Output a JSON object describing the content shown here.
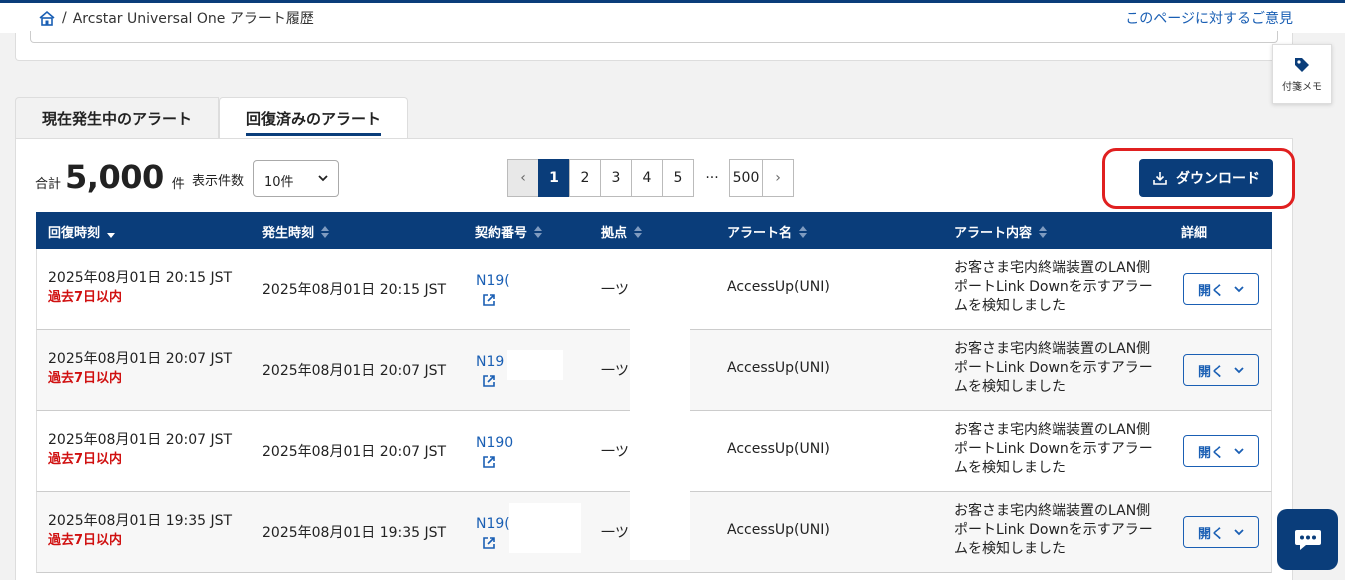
{
  "breadcrumb": {
    "separator": "/",
    "current": "Arcstar Universal One アラート履歴"
  },
  "feedback_link": "このページに対するご意見",
  "memo_button": {
    "label": "付箋メモ",
    "icon": "tag-icon"
  },
  "tabs": [
    {
      "label": "現在発生中のアラート",
      "active": false
    },
    {
      "label": "回復済みのアラート",
      "active": true
    }
  ],
  "summary": {
    "total_label": "合計",
    "total_count": "5,000",
    "total_unit": "件",
    "per_page_label": "表示件数",
    "per_page_value": "10件"
  },
  "pagination": {
    "prev": "‹",
    "pages": [
      "1",
      "2",
      "3",
      "4",
      "5"
    ],
    "ellipsis": "···",
    "last": "500",
    "next": "›",
    "current": "1"
  },
  "download_label": "ダウンロード",
  "table": {
    "headers": [
      "回復時刻",
      "発生時刻",
      "契約番号",
      "拠点",
      "アラート名",
      "アラート内容",
      "詳細"
    ],
    "rows": [
      {
        "recovered": "2025年08月01日 20:15 JST",
        "recent": "過去7日以内",
        "occurred": "2025年08月01日 20:15 JST",
        "contract": "N19(",
        "site": "一ツ",
        "alert_name": "AccessUp(UNI)",
        "alert_desc": "お客さま宅内終端装置のLAN側ポートLink Downを示すアラームを検知しました",
        "action": "開く"
      },
      {
        "recovered": "2025年08月01日 20:07 JST",
        "recent": "過去7日以内",
        "occurred": "2025年08月01日 20:07 JST",
        "contract": "N19",
        "site": "一ツ",
        "alert_name": "AccessUp(UNI)",
        "alert_desc": "お客さま宅内終端装置のLAN側ポートLink Downを示すアラームを検知しました",
        "action": "開く"
      },
      {
        "recovered": "2025年08月01日 20:07 JST",
        "recent": "過去7日以内",
        "occurred": "2025年08月01日 20:07 JST",
        "contract": "N190",
        "site": "一ツ",
        "alert_name": "AccessUp(UNI)",
        "alert_desc": "お客さま宅内終端装置のLAN側ポートLink Downを示すアラームを検知しました",
        "action": "開く"
      },
      {
        "recovered": "2025年08月01日 19:35 JST",
        "recent": "過去7日以内",
        "occurred": "2025年08月01日 19:35 JST",
        "contract": "N19(",
        "site": "一ツ",
        "alert_name": "AccessUp(UNI)",
        "alert_desc": "お客さま宅内終端装置のLAN側ポートLink Downを示すアラームを検知しました",
        "action": "開く"
      }
    ]
  },
  "colors": {
    "brand": "#0a3d7a",
    "link": "#1a5fb4",
    "alert_red": "#d01010",
    "highlight": "#e02020"
  }
}
